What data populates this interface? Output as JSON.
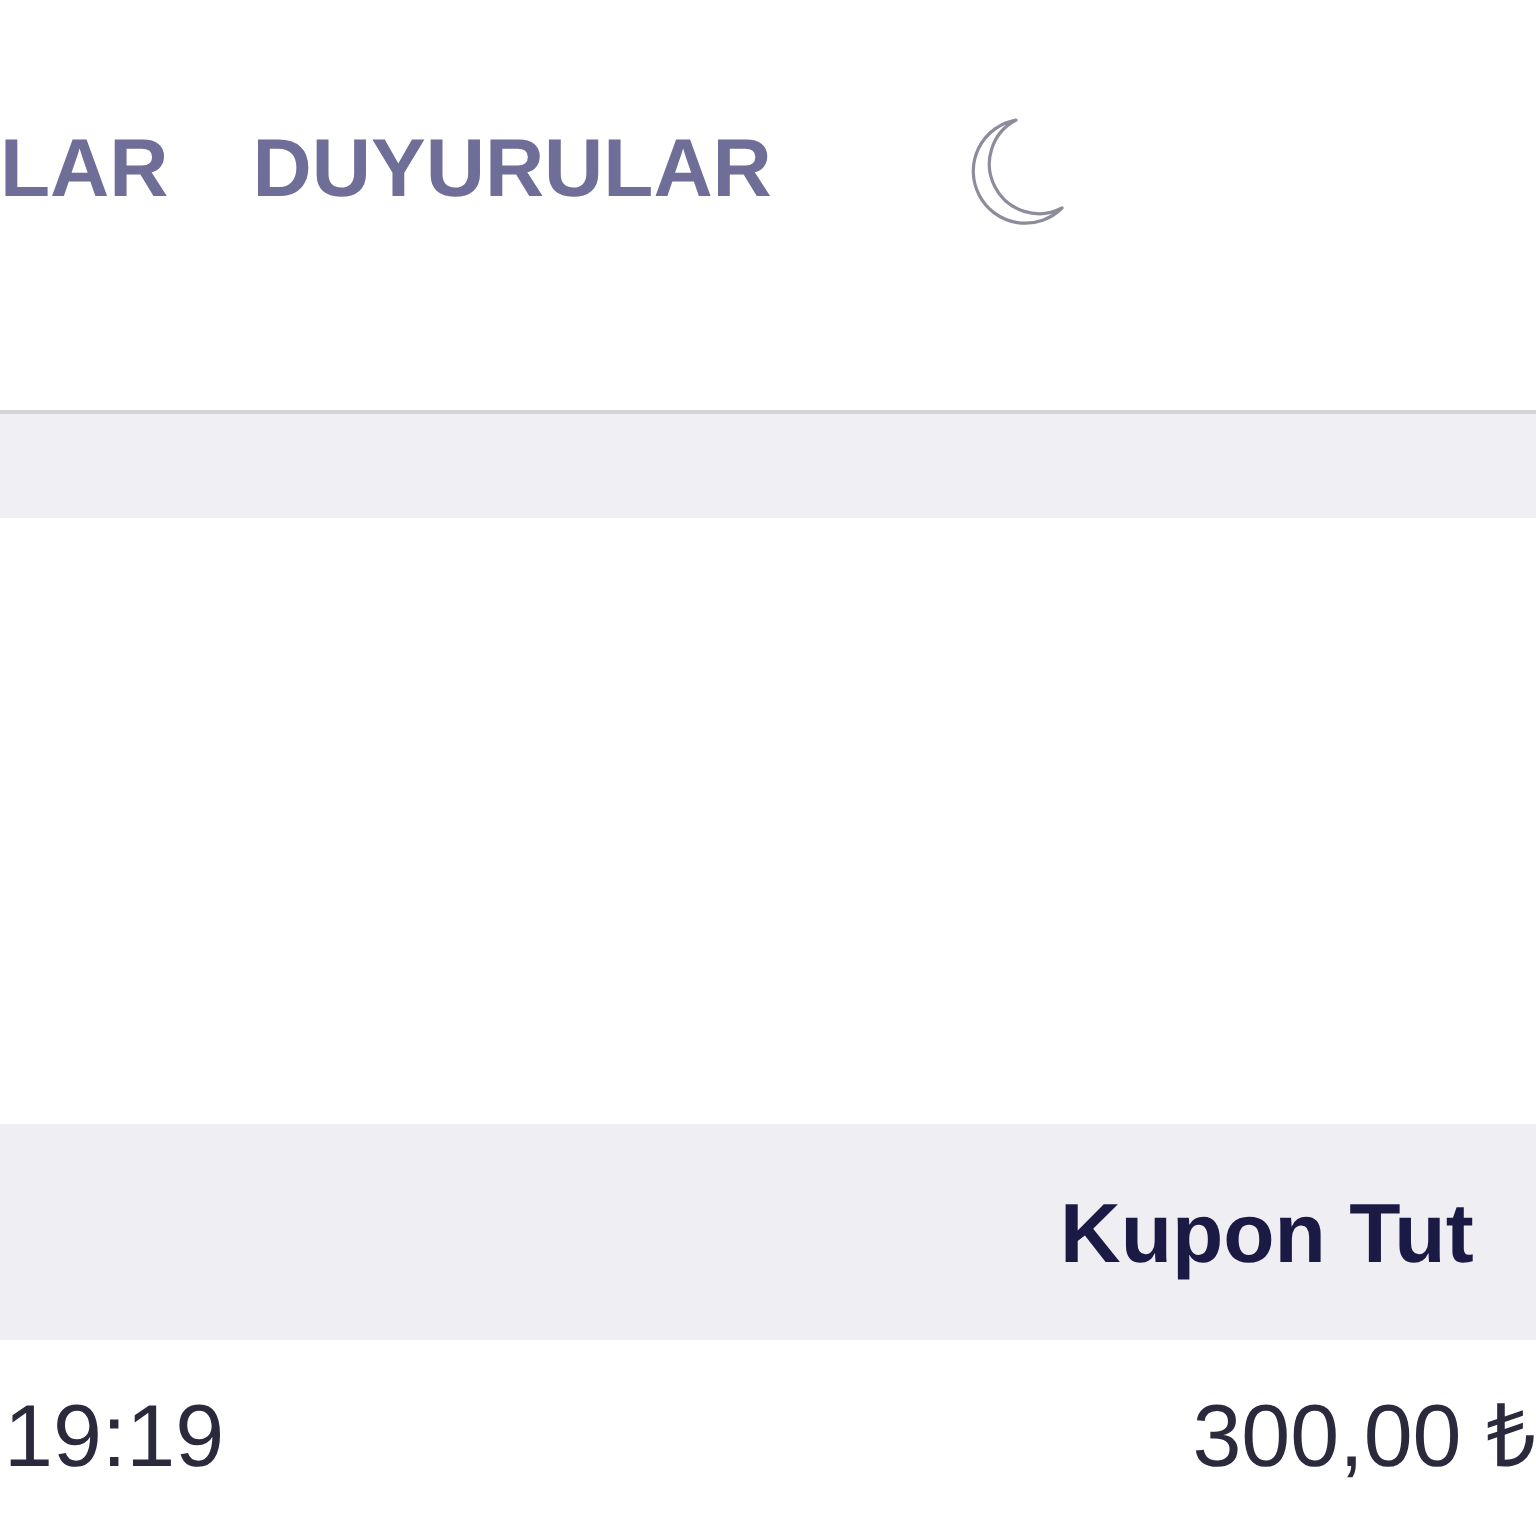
{
  "nav": {
    "items": [
      {
        "label": "LAR"
      },
      {
        "label": "DUYURULAR"
      }
    ]
  },
  "table": {
    "header": {
      "column_2": "Kupon Tut"
    },
    "rows": [
      {
        "column_1": "19:19",
        "column_2": "300,00 ₺"
      }
    ]
  }
}
